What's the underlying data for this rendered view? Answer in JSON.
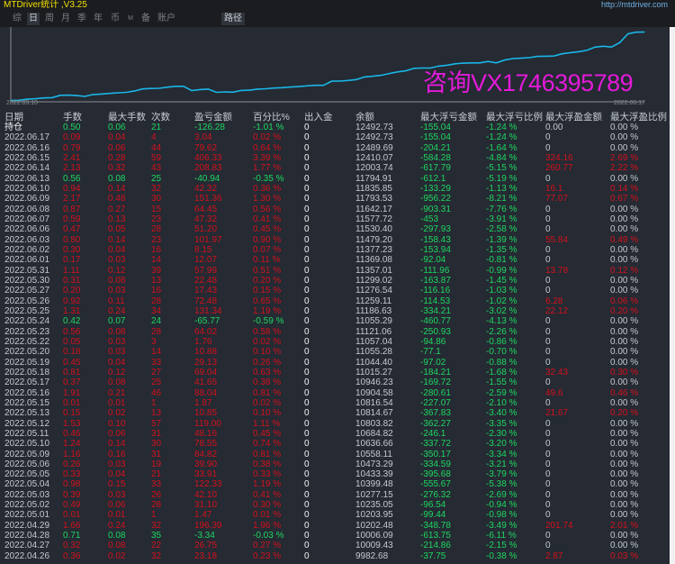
{
  "app": {
    "title": "MTDriver统计 ,V3.25",
    "site_link": "http://mtdriver.com"
  },
  "toolbar": {
    "buttons": [
      {
        "label": "综",
        "active": false
      },
      {
        "label": "日",
        "active": true
      },
      {
        "label": "周",
        "active": false
      },
      {
        "label": "月",
        "active": false
      },
      {
        "label": "季",
        "active": false
      },
      {
        "label": "年",
        "active": false
      },
      {
        "label": "币",
        "active": false
      },
      {
        "label": "M",
        "active": false
      },
      {
        "label": "备",
        "active": false
      },
      {
        "label": "账户",
        "active": false
      }
    ],
    "path_label": "路径"
  },
  "colors": {
    "line": "#1ab6e6",
    "profit": "#d3111c",
    "loss": "#1ed760",
    "watermark": "#e31ad8",
    "title": "#f0e000",
    "link": "#6fb2e8"
  },
  "chart_data": {
    "type": "line",
    "title": "",
    "xlabel": "",
    "ylabel": "",
    "x_start_label": "2022.03.10",
    "x_end_label": "2022.06.17",
    "grid": false,
    "watermark": "咨询VX1746395789",
    "series": [
      {
        "name": "余额",
        "values": [
          9300,
          9310,
          9360,
          9380,
          9420,
          9430,
          9540,
          9550,
          9530,
          9490,
          9580,
          9600,
          9630,
          9660,
          9680,
          9740,
          9840,
          9860,
          9870,
          9920,
          9960,
          9960,
          9760,
          9810,
          9830,
          9680,
          9700,
          9690,
          9770,
          9780,
          9830,
          9850,
          9880,
          9900,
          9930,
          9950,
          9982.68,
          10009.43,
          10006.09,
          10202.48,
          10203.95,
          10235.05,
          10277.15,
          10399.48,
          10433.39,
          10473.29,
          10558.11,
          10636.66,
          10684.82,
          10803.82,
          10814.67,
          10816.54,
          10904.58,
          10946.23,
          11015.27,
          11044.4,
          11055.28,
          11057.04,
          11121.06,
          11055.29,
          11186.63,
          11259.11,
          11276.54,
          11299.02,
          11357.01,
          11369.08,
          11377.23,
          11479.2,
          11530.4,
          11577.72,
          11642.17,
          11793.53,
          11835.85,
          11794.91,
          12003.74,
          12410.07,
          12489.69,
          12492.73
        ]
      }
    ],
    "ylim": [
      9280,
      12520
    ]
  },
  "table": {
    "headers": [
      "日期",
      "手数",
      "最大手数",
      "次数",
      "盈亏金额",
      "百分比%",
      "出入金",
      "余额",
      "最大浮亏金额",
      "最大浮亏比例",
      "最大浮盈金额",
      "最大浮盈比例"
    ],
    "rows": [
      [
        "持仓",
        "0.50",
        "0.06",
        "21",
        "-126.28",
        "-1.01 %",
        "0",
        "12492.73",
        "-155.04",
        "-1.24 %",
        "0.00",
        "0.00 %"
      ],
      [
        "2022.06.17",
        "0.09",
        "0.04",
        "4",
        "3.04",
        "0.02 %",
        "0",
        "12492.73",
        "-155.04",
        "-1.24 %",
        "0",
        "0.00 %"
      ],
      [
        "2022.06.16",
        "0.79",
        "0.06",
        "44",
        "79.62",
        "0.64 %",
        "0",
        "12489.69",
        "-204.21",
        "-1.64 %",
        "0",
        "0.00 %"
      ],
      [
        "2022.06.15",
        "2.41",
        "0.28",
        "59",
        "406.33",
        "3.39 %",
        "0",
        "12410.07",
        "-584.28",
        "-4.84 %",
        "324.16",
        "2.69 %"
      ],
      [
        "2022.06.14",
        "2.13",
        "0.32",
        "43",
        "208.83",
        "1.77 %",
        "0",
        "12003.74",
        "-617.79",
        "-5.15 %",
        "260.77",
        "2.22 %"
      ],
      [
        "2022.06.13",
        "0.56",
        "0.08",
        "25",
        "-40.94",
        "-0.35 %",
        "0",
        "11794.91",
        "-612.1",
        "-5.19 %",
        "0",
        "0.00 %"
      ],
      [
        "2022.06.10",
        "0.94",
        "0.14",
        "32",
        "42.32",
        "0.36 %",
        "0",
        "11835.85",
        "-133.29",
        "-1.13 %",
        "16.1",
        "0.14 %"
      ],
      [
        "2022.06.09",
        "2.17",
        "0.48",
        "30",
        "151.36",
        "1.30 %",
        "0",
        "11793.53",
        "-956.22",
        "-8.21 %",
        "77.07",
        "0.67 %"
      ],
      [
        "2022.06.08",
        "0.87",
        "0.27",
        "15",
        "64.45",
        "0.56 %",
        "0",
        "11642.17",
        "-903.31",
        "-7.76 %",
        "0",
        "0.00 %"
      ],
      [
        "2022.06.07",
        "0.59",
        "0.13",
        "23",
        "47.32",
        "0.41 %",
        "0",
        "11577.72",
        "-453",
        "-3.91 %",
        "0",
        "0.00 %"
      ],
      [
        "2022.06.06",
        "0.47",
        "0.05",
        "28",
        "51.20",
        "0.45 %",
        "0",
        "11530.40",
        "-297.93",
        "-2.58 %",
        "0",
        "0.00 %"
      ],
      [
        "2022.06.03",
        "0.80",
        "0.14",
        "23",
        "101.97",
        "0.90 %",
        "0",
        "11479.20",
        "-158.43",
        "-1.39 %",
        "55.84",
        "0.49 %"
      ],
      [
        "2022.06.02",
        "0.30",
        "0.04",
        "16",
        "8.15",
        "0.07 %",
        "0",
        "11377.23",
        "-153.94",
        "-1.35 %",
        "0",
        "0.00 %"
      ],
      [
        "2022.06.01",
        "0.17",
        "0.03",
        "14",
        "12.07",
        "0.11 %",
        "0",
        "11369.08",
        "-92.04",
        "-0.81 %",
        "0",
        "0.00 %"
      ],
      [
        "2022.05.31",
        "1.11",
        "0.12",
        "39",
        "57.99",
        "0.51 %",
        "0",
        "11357.01",
        "-111.96",
        "-0.99 %",
        "13.78",
        "0.12 %"
      ],
      [
        "2022.05.30",
        "0.31",
        "0.08",
        "13",
        "22.48",
        "0.20 %",
        "0",
        "11299.02",
        "-163.87",
        "-1.45 %",
        "0",
        "0.00 %"
      ],
      [
        "2022.05.27",
        "0.20",
        "0.03",
        "16",
        "17.43",
        "0.15 %",
        "0",
        "11276.54",
        "-116.16",
        "-1.03 %",
        "0",
        "0.00 %"
      ],
      [
        "2022.05.26",
        "0.92",
        "0.11",
        "28",
        "72.48",
        "0.65 %",
        "0",
        "11259.11",
        "-114.53",
        "-1.02 %",
        "6.28",
        "0.06 %"
      ],
      [
        "2022.05.25",
        "1.31",
        "0.24",
        "34",
        "131.34",
        "1.19 %",
        "0",
        "11186.63",
        "-334.21",
        "-3.02 %",
        "22.12",
        "0.20 %"
      ],
      [
        "2022.05.24",
        "0.42",
        "0.07",
        "24",
        "-65.77",
        "-0.59 %",
        "0",
        "11055.29",
        "-460.77",
        "-4.13 %",
        "0",
        "0.00 %"
      ],
      [
        "2022.05.23",
        "0.56",
        "0.08",
        "28",
        "64.02",
        "0.58 %",
        "0",
        "11121.06",
        "-250.93",
        "-2.26 %",
        "0",
        "0.00 %"
      ],
      [
        "2022.05.22",
        "0.05",
        "0.03",
        "3",
        "1.76",
        "0.02 %",
        "0",
        "11057.04",
        "-94.86",
        "-0.86 %",
        "0",
        "0.00 %"
      ],
      [
        "2022.05.20",
        "0.18",
        "0.03",
        "14",
        "10.88",
        "0.10 %",
        "0",
        "11055.28",
        "-77.1",
        "-0.70 %",
        "0",
        "0.00 %"
      ],
      [
        "2022.05.19",
        "0.45",
        "0.04",
        "33",
        "29.13",
        "0.26 %",
        "0",
        "11044.40",
        "-97.02",
        "-0.88 %",
        "0",
        "0.00 %"
      ],
      [
        "2022.05.18",
        "0.81",
        "0.12",
        "27",
        "69.04",
        "0.63 %",
        "0",
        "11015.27",
        "-184.21",
        "-1.68 %",
        "32.43",
        "0.30 %"
      ],
      [
        "2022.05.17",
        "0.37",
        "0.08",
        "25",
        "41.65",
        "0.38 %",
        "0",
        "10946.23",
        "-169.72",
        "-1.55 %",
        "0",
        "0.00 %"
      ],
      [
        "2022.05.16",
        "1.91",
        "0.21",
        "46",
        "88.04",
        "0.81 %",
        "0",
        "10904.58",
        "-280.61",
        "-2.59 %",
        "49.6",
        "0.46 %"
      ],
      [
        "2022.05.15",
        "0.01",
        "0.01",
        "1",
        "1.87",
        "0.02 %",
        "0",
        "10816.54",
        "-227.07",
        "-2.10 %",
        "0",
        "0.00 %"
      ],
      [
        "2022.05.13",
        "0.15",
        "0.02",
        "13",
        "10.85",
        "0.10 %",
        "0",
        "10814.67",
        "-367.83",
        "-3.40 %",
        "21.67",
        "0.20 %"
      ],
      [
        "2022.05.12",
        "1.53",
        "0.10",
        "57",
        "119.00",
        "1.11 %",
        "0",
        "10803.82",
        "-362.27",
        "-3.35 %",
        "0",
        "0.00 %"
      ],
      [
        "2022.05.11",
        "0.46",
        "0.06",
        "31",
        "48.16",
        "0.45 %",
        "0",
        "10684.82",
        "-246.1",
        "-2.30 %",
        "0",
        "0.00 %"
      ],
      [
        "2022.05.10",
        "1.24",
        "0.14",
        "30",
        "78.55",
        "0.74 %",
        "0",
        "10636.66",
        "-337.72",
        "-3.20 %",
        "0",
        "0.00 %"
      ],
      [
        "2022.05.09",
        "1.16",
        "0.16",
        "31",
        "84.82",
        "0.81 %",
        "0",
        "10558.11",
        "-350.17",
        "-3.34 %",
        "0",
        "0.00 %"
      ],
      [
        "2022.05.06",
        "0.26",
        "0.03",
        "19",
        "39.90",
        "0.38 %",
        "0",
        "10473.29",
        "-334.59",
        "-3.21 %",
        "0",
        "0.00 %"
      ],
      [
        "2022.05.05",
        "0.33",
        "0.04",
        "21",
        "33.91",
        "0.33 %",
        "0",
        "10433.39",
        "-395.68",
        "-3.79 %",
        "0",
        "0.00 %"
      ],
      [
        "2022.05.04",
        "0.98",
        "0.15",
        "33",
        "122.33",
        "1.19 %",
        "0",
        "10399.48",
        "-555.67",
        "-5.38 %",
        "0",
        "0.00 %"
      ],
      [
        "2022.05.03",
        "0.39",
        "0.03",
        "26",
        "42.10",
        "0.41 %",
        "0",
        "10277.15",
        "-276.32",
        "-2.69 %",
        "0",
        "0.00 %"
      ],
      [
        "2022.05.02",
        "0.49",
        "0.06",
        "28",
        "31.10",
        "0.30 %",
        "0",
        "10235.05",
        "-96.54",
        "-0.94 %",
        "0",
        "0.00 %"
      ],
      [
        "2022.05.01",
        "0.01",
        "0.01",
        "1",
        "1.47",
        "0.01 %",
        "0",
        "10203.95",
        "-99.44",
        "-0.98 %",
        "0",
        "0.00 %"
      ],
      [
        "2022.04.29",
        "1.66",
        "0.24",
        "32",
        "196.39",
        "1.96 %",
        "0",
        "10202.48",
        "-348.78",
        "-3.49 %",
        "201.74",
        "2.01 %"
      ],
      [
        "2022.04.28",
        "0.71",
        "0.08",
        "35",
        "-3.34",
        "-0.03 %",
        "0",
        "10006.09",
        "-613.75",
        "-6.11 %",
        "0",
        "0.00 %"
      ],
      [
        "2022.04.27",
        "0.32",
        "0.08",
        "22",
        "26.75",
        "0.27 %",
        "0",
        "10009.43",
        "-214.86",
        "-2.15 %",
        "0",
        "0.00 %"
      ],
      [
        "2022.04.26",
        "0.36",
        "0.02",
        "32",
        "23.18",
        "0.23 %",
        "0",
        "9982.68",
        "-37.75",
        "-0.38 %",
        "2.87",
        "0.03 %"
      ]
    ]
  }
}
